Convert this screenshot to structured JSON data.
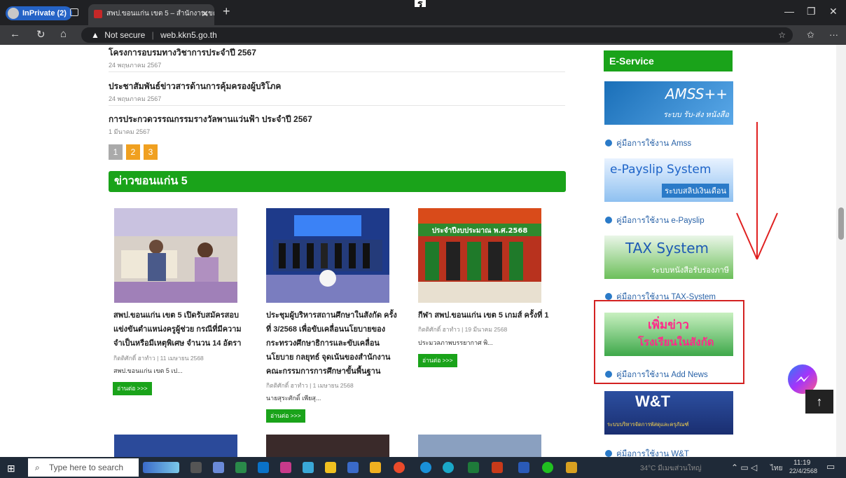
{
  "browser": {
    "inprivate_label": "InPrivate (2)",
    "tab_title": "สพป.ขอนแก่น เขต 5 – สำนักงานเขตพื้",
    "new_tab": "+",
    "url_warning": "Not secure",
    "url": "web.kkn5.go.th",
    "top_glyph": "ร"
  },
  "news_list": [
    {
      "title": "โครงการอบรมทางวิชาการประจำปี 2567",
      "date": "24 พฤษภาคม 2567"
    },
    {
      "title": "ประชาสัมพันธ์ข่าวสารด้านการคุ้มครองผู้บริโภค",
      "date": "24 พฤษภาคม 2567"
    },
    {
      "title": "การประกวดวรรณกรรมรางวัลพานแว่นฟ้า ประจำปี 2567",
      "date": "1 มีนาคม 2567"
    }
  ],
  "pagination": [
    "1",
    "2",
    "3"
  ],
  "section_title": "ข่าวขอนแก่น 5",
  "cards": [
    {
      "title_lines": [
        "สพป.ขอนแก่น เขต 5 เปิดรับสมัครสอบ",
        "แข่งขันตำแหน่งครูผู้ช่วย กรณีที่มีความ",
        "จำเป็นหรือมีเหตุพิเศษ จำนวน 14 อัตรา"
      ],
      "meta": "กิตติศักดิ์ ฮาทำว | 11 เมษายน 2568",
      "excerpt": "สพป.ขอนแก่น เขต 5 เป...",
      "more": "อ่านต่อ >>>"
    },
    {
      "title_lines": [
        "ประชุมผู้บริหารสถานศึกษาในสังกัด ครั้ง",
        "ที่ 3/2568 เพื่อขับเคลื่อนนโยบายของ",
        "กระทรวงศึกษาธิการและขับเคลื่อน",
        "นโยบาย กลยุทธ์ จุดเน้นของสำนักงาน",
        "คณะกรรมการการศึกษาขั้นพื้นฐาน"
      ],
      "meta": "กิตติศักดิ์ ฮาทำว | 1 เมษายน 2568",
      "excerpt": "นายสุระศักดิ์ เพียสุ...",
      "more": "อ่านต่อ >>>"
    },
    {
      "title_lines": [
        "กีฬา สพป.ขอนแก่น เขต 5 เกมส์ ครั้งที่ 1"
      ],
      "meta": "กิตติศักดิ์ ฮาทำว | 19 มีนาคม 2568",
      "excerpt": "ประมวลภาพบรรยากาศ พิ...",
      "more": "อ่านต่อ >>>",
      "banner_text": "ประจำปีงบประมาณ พ.ศ.2568"
    }
  ],
  "sidebar": {
    "title": "E-Service",
    "items": [
      {
        "banner": "AMSS++",
        "banner_sub": "ระบบ รับ-ส่ง หนังสือ",
        "link": "คู่มือการใช้งาน Amss"
      },
      {
        "banner": "e-Payslip System",
        "banner_sub": "ระบบสลิปเงินเดือน",
        "link": "คู่มือการใช้งาน e-Payslip"
      },
      {
        "banner": "TAX System",
        "banner_sub": "ระบบหนังสือรับรองภาษี",
        "link": "คู่มือการใช้งาน TAX-System"
      },
      {
        "banner": "เพิ่มข่าว",
        "banner_sub": "โรงเรียนในสังกัด",
        "link": "คู่มือการใช้งาน Add News"
      },
      {
        "banner": "W&T",
        "banner_sub": "ระบบบริหารจัดการพัสดุและครุภัณฑ์",
        "link": "คู่มือการใช้งาน W&T"
      }
    ]
  },
  "taskbar": {
    "search_placeholder": "Type here to search",
    "weather": "34°C มีเมฆส่วนใหญ่",
    "lang": "ไทย",
    "time": "11:19",
    "date": "22/4/2568"
  },
  "colors": {
    "green": "#1aa31a",
    "orange": "#f0a020",
    "highlight": "#d32222",
    "arrow": "#e02020"
  }
}
